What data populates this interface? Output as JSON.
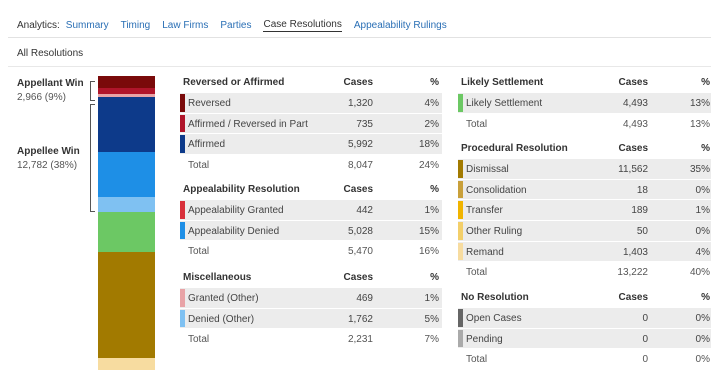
{
  "nav": {
    "label": "Analytics:",
    "tabs": [
      {
        "label": "Summary",
        "active": false
      },
      {
        "label": "Timing",
        "active": false
      },
      {
        "label": "Law Firms",
        "active": false
      },
      {
        "label": "Parties",
        "active": false
      },
      {
        "label": "Case Resolutions",
        "active": true
      },
      {
        "label": "Appealability Rulings",
        "active": false
      }
    ]
  },
  "section_title": "All Resolutions",
  "side": {
    "appellant": {
      "title": "Appellant Win",
      "value": "2,966 (9%)"
    },
    "appellee": {
      "title": "Appellee Win",
      "value": "12,782 (38%)"
    }
  },
  "stack_segments": [
    {
      "label": "Reversed",
      "pct": 4,
      "color": "#7a0a0a"
    },
    {
      "label": "Affirmed / Reversed in Part",
      "pct": 2,
      "color": "#b0152a"
    },
    {
      "label": "Granted (Other)",
      "pct": 1,
      "color": "#e8a3a6"
    },
    {
      "label": "Affirmed",
      "pct": 18,
      "color": "#0d3a8a"
    },
    {
      "label": "Appealability Denied",
      "pct": 15,
      "color": "#1e8fe6"
    },
    {
      "label": "Denied (Other)",
      "pct": 5,
      "color": "#7fc1f2"
    },
    {
      "label": "Likely Settlement",
      "pct": 13,
      "color": "#6cc864"
    },
    {
      "label": "Dismissal",
      "pct": 35,
      "color": "#a27a00"
    },
    {
      "label": "Remand",
      "pct": 4,
      "color": "#f7dca0"
    }
  ],
  "tables": {
    "reversed": {
      "title": "Reversed or Affirmed",
      "cases_label": "Cases",
      "pct_label": "%",
      "rows": [
        {
          "name": "Reversed",
          "cases": "1,320",
          "pct": "4%",
          "color": "#7a0a0a"
        },
        {
          "name": "Affirmed / Reversed in Part",
          "cases": "735",
          "pct": "2%",
          "color": "#b0152a"
        },
        {
          "name": "Affirmed",
          "cases": "5,992",
          "pct": "18%",
          "color": "#0d3a8a"
        }
      ],
      "total": {
        "name": "Total",
        "cases": "8,047",
        "pct": "24%"
      }
    },
    "appealability": {
      "title": "Appealability Resolution",
      "cases_label": "Cases",
      "pct_label": "%",
      "rows": [
        {
          "name": "Appealability Granted",
          "cases": "442",
          "pct": "1%",
          "color": "#d8303a"
        },
        {
          "name": "Appealability Denied",
          "cases": "5,028",
          "pct": "15%",
          "color": "#1e8fe6"
        }
      ],
      "total": {
        "name": "Total",
        "cases": "5,470",
        "pct": "16%"
      }
    },
    "misc": {
      "title": "Miscellaneous",
      "cases_label": "Cases",
      "pct_label": "%",
      "rows": [
        {
          "name": "Granted (Other)",
          "cases": "469",
          "pct": "1%",
          "color": "#e8a3a6"
        },
        {
          "name": "Denied (Other)",
          "cases": "1,762",
          "pct": "5%",
          "color": "#7fc1f2"
        }
      ],
      "total": {
        "name": "Total",
        "cases": "2,231",
        "pct": "7%"
      }
    },
    "settlement": {
      "title": "Likely Settlement",
      "cases_label": "Cases",
      "pct_label": "%",
      "rows": [
        {
          "name": "Likely Settlement",
          "cases": "4,493",
          "pct": "13%",
          "color": "#6cc864"
        }
      ],
      "total": {
        "name": "Total",
        "cases": "4,493",
        "pct": "13%"
      }
    },
    "procedural": {
      "title": "Procedural Resolution",
      "cases_label": "Cases",
      "pct_label": "%",
      "rows": [
        {
          "name": "Dismissal",
          "cases": "11,562",
          "pct": "35%",
          "color": "#a27a00"
        },
        {
          "name": "Consolidation",
          "cases": "18",
          "pct": "0%",
          "color": "#c9a03a"
        },
        {
          "name": "Transfer",
          "cases": "189",
          "pct": "1%",
          "color": "#f0b400"
        },
        {
          "name": "Other Ruling",
          "cases": "50",
          "pct": "0%",
          "color": "#f3cf6a"
        },
        {
          "name": "Remand",
          "cases": "1,403",
          "pct": "4%",
          "color": "#f7dca0"
        }
      ],
      "total": {
        "name": "Total",
        "cases": "13,222",
        "pct": "40%"
      }
    },
    "noresolution": {
      "title": "No Resolution",
      "cases_label": "Cases",
      "pct_label": "%",
      "rows": [
        {
          "name": "Open Cases",
          "cases": "0",
          "pct": "0%",
          "color": "#666666"
        },
        {
          "name": "Pending",
          "cases": "0",
          "pct": "0%",
          "color": "#aaaaaa"
        }
      ],
      "total": {
        "name": "Total",
        "cases": "0",
        "pct": "0%"
      }
    }
  }
}
